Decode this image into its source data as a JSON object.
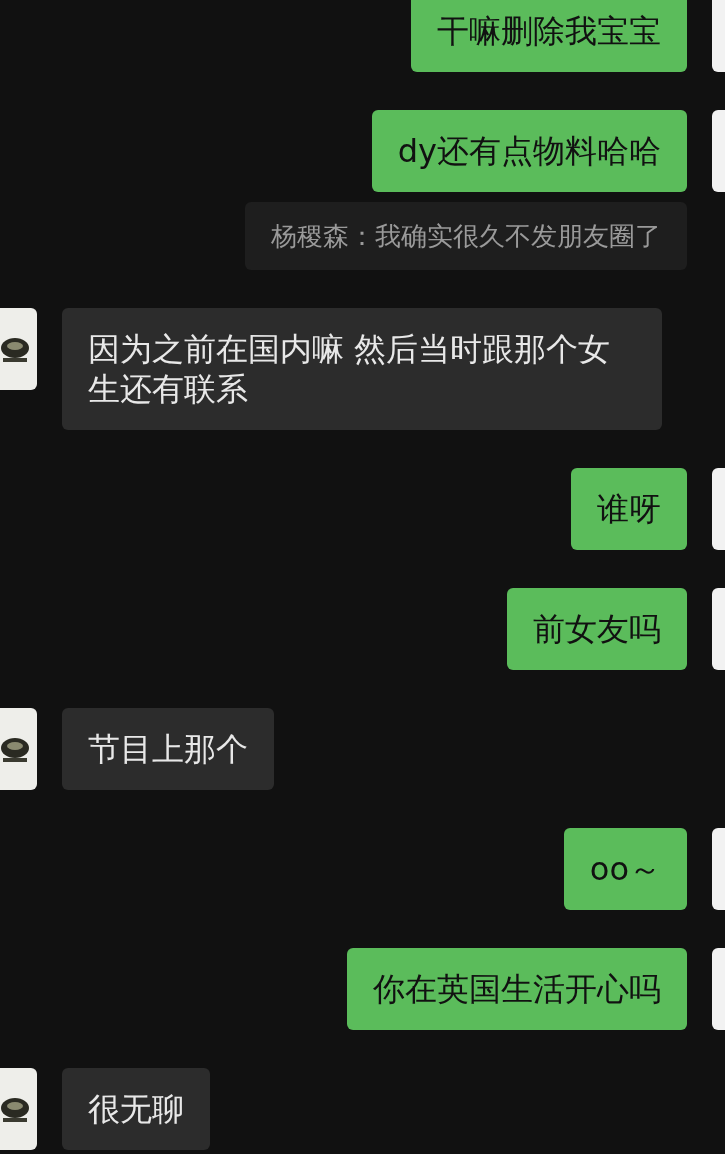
{
  "messages": [
    {
      "kind": "sent",
      "text": "干嘛删除我宝宝"
    },
    {
      "kind": "sent",
      "text": "dy还有点物料哈哈",
      "quote": "杨稷森：我确实很久不发朋友圈了"
    },
    {
      "kind": "received",
      "text": "因为之前在国内嘛 然后当时跟那个女生还有联系"
    },
    {
      "kind": "sent",
      "text": "谁呀"
    },
    {
      "kind": "sent",
      "text": "前女友吗"
    },
    {
      "kind": "received",
      "text": "节目上那个"
    },
    {
      "kind": "sent",
      "text": "oo～"
    },
    {
      "kind": "sent",
      "text": "你在英国生活开心吗"
    },
    {
      "kind": "received",
      "text": "很无聊"
    }
  ]
}
